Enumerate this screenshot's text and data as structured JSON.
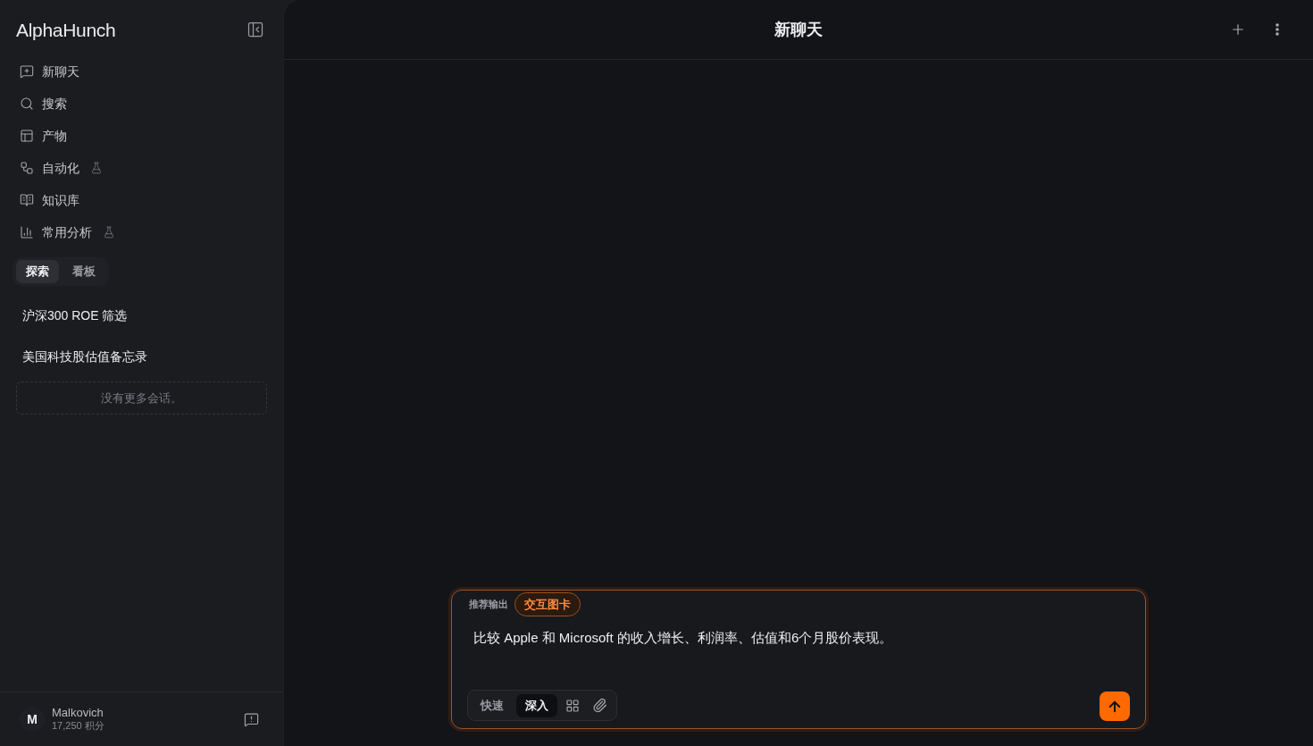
{
  "sidebar": {
    "logo": "AlphaHunch",
    "nav": [
      {
        "label": "新聊天",
        "beta": false
      },
      {
        "label": "搜索",
        "beta": false
      },
      {
        "label": "产物",
        "beta": false
      },
      {
        "label": "自动化",
        "beta": true
      },
      {
        "label": "知识库",
        "beta": false
      },
      {
        "label": "常用分析",
        "beta": true
      }
    ],
    "tabs": [
      {
        "label": "探索",
        "selected": true
      },
      {
        "label": "看板",
        "selected": false
      }
    ],
    "conversations": [
      "沪深300 ROE 筛选",
      "美国科技股估值备忘录"
    ],
    "empty_note": "没有更多会话。",
    "user": {
      "initial": "M",
      "name": "Malkovich",
      "points": "17,250 积分"
    }
  },
  "header": {
    "title": "新聊天"
  },
  "composer": {
    "output_label": "推荐输出",
    "output_chip": "交互图卡",
    "value": "比较 Apple 和 Microsoft 的收入增长、利润率、估值和6个月股价表现。",
    "modes": [
      {
        "label": "快速",
        "selected": false
      },
      {
        "label": "深入",
        "selected": true
      }
    ]
  }
}
